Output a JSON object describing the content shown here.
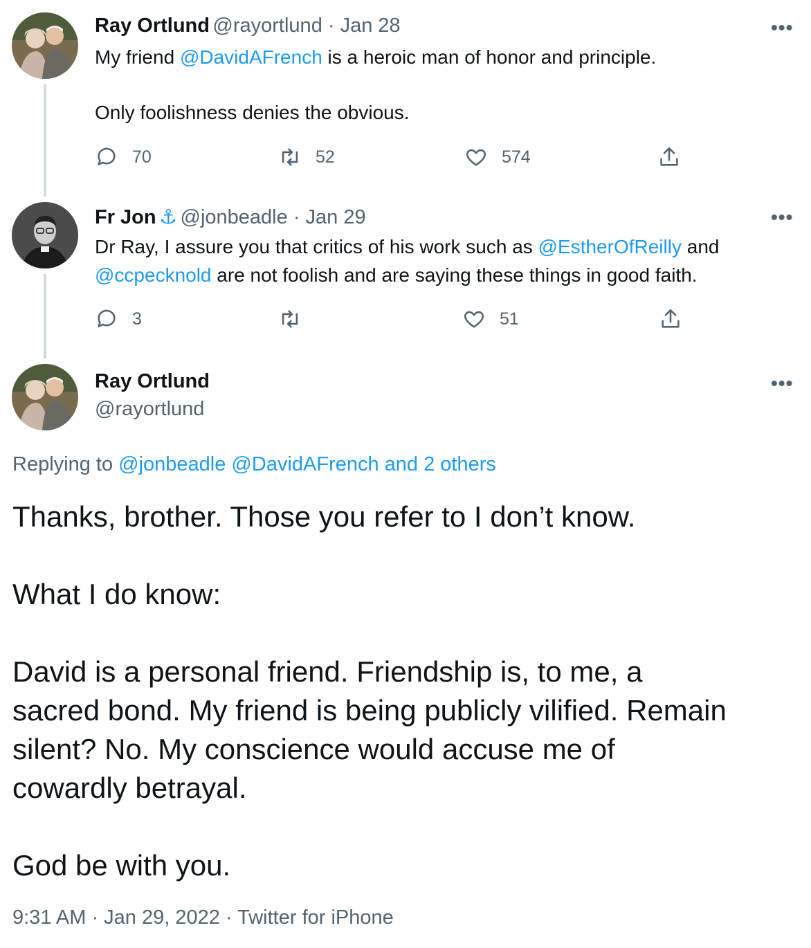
{
  "tweet1": {
    "name": "Ray Ortlund",
    "handle": "@rayortlund",
    "date": "Jan 28",
    "line1_pre": "My friend ",
    "line1_mention": "@DavidAFrench",
    "line1_post": " is a heroic man of honor and principle.",
    "line2": "Only foolishness denies the obvious.",
    "replies": "70",
    "retweets": "52",
    "likes": "574"
  },
  "tweet2": {
    "name": "Fr Jon",
    "name_emoji": "⚓",
    "handle": "@jonbeadle",
    "date": "Jan 29",
    "line1_pre": "Dr Ray, I assure you that critics of his work such as ",
    "line1_mention": "@EstherOfReilly",
    "line1_post": " and",
    "line2_mention": "@ccpecknold",
    "line2_post": " are not foolish and are saying these things in good faith.",
    "replies": "3",
    "retweets": "",
    "likes": "51"
  },
  "main_tweet": {
    "name": "Ray Ortlund",
    "handle": "@rayortlund",
    "replying_label": "Replying to ",
    "replying_mentions": "@jonbeadle @DavidAFrench and 2 others",
    "lines": [
      "Thanks, brother. Those you refer to I don’t know.",
      "What I do know:",
      "David is a personal friend. Friendship is, to me, a",
      "sacred bond. My friend is being publicly vilified. Remain",
      "silent? No. My conscience would accuse me of",
      "cowardly betrayal.",
      "God be with you."
    ],
    "timestamp": "9:31 AM · Jan 29, 2022 · Twitter for iPhone"
  },
  "more_label": "•••",
  "separator": " · ",
  "icons": [
    "reply-icon",
    "retweet-icon",
    "like-icon",
    "share-icon",
    "more-icon",
    "anchor-icon"
  ],
  "colors": {
    "link": "#1d9bf0",
    "secondary": "#536471",
    "text": "#0f1419",
    "thread_line": "#cfd9de"
  }
}
